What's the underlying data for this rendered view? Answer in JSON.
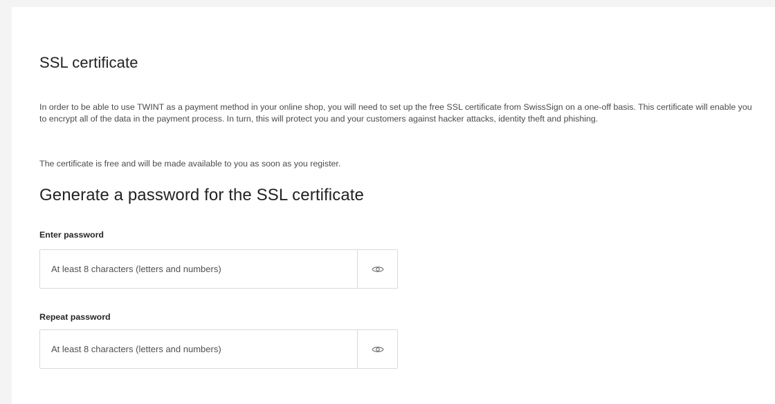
{
  "ssl": {
    "title": "SSL certificate",
    "intro": "In order to be able to use TWINT as a payment method in your online shop, you will need to set up the free SSL certificate from SwissSign on a one-off basis. This certificate will enable you to encrypt all of the data in the payment process. In turn, this will protect you and your customers against hacker attacks, identity theft and phishing.",
    "note": "The certificate is free and will be made available to you as soon as you register."
  },
  "password_form": {
    "title": "Generate a password for the SSL certificate",
    "enter": {
      "label": "Enter password",
      "placeholder": "At least 8 characters (letters and numbers)",
      "value": ""
    },
    "repeat": {
      "label": "Repeat password",
      "placeholder": "At least 8 characters (letters and numbers)",
      "value": ""
    },
    "toggle_icon": "eye-icon"
  },
  "colors": {
    "page_background": "#f4f4f4",
    "card_background": "#ffffff",
    "border": "#d9d9d9",
    "text": "#262626"
  }
}
